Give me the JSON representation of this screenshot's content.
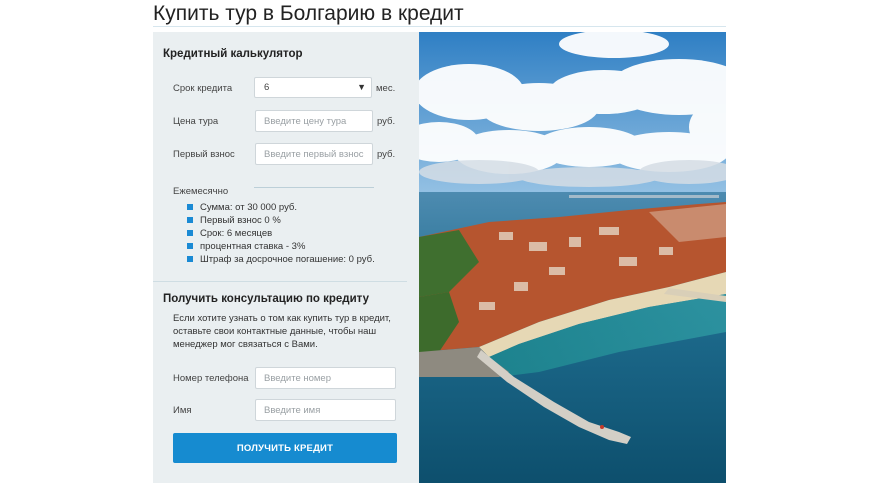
{
  "page": {
    "title": "Купить тур в Болгарию в кредит"
  },
  "calculator": {
    "heading": "Кредитный калькулятор",
    "term": {
      "label": "Срок кредита",
      "value": "6",
      "unit": "мес."
    },
    "price": {
      "label": "Цена тура",
      "placeholder": "Введите цену тура",
      "unit": "руб."
    },
    "down_payment": {
      "label": "Первый взнос",
      "placeholder": "Введите первый взнос",
      "unit": "руб."
    },
    "monthly_label": "Ежемесячно",
    "conditions": [
      "Сумма: от 30 000 руб.",
      "Первый взнос 0 %",
      "Срок: 6 месяцев",
      "процентная ставка - 3%",
      "Штраф за досрочное погашение: 0 руб."
    ]
  },
  "consultation": {
    "heading": "Получить консультацию по кредиту",
    "description": "Если хотите узнать о том как купить тур в кредит, оставьте свои контактные данные, чтобы наш менеджер мог связаться с Вами.",
    "phone": {
      "label": "Номер телефона",
      "placeholder": "Введите номер"
    },
    "name": {
      "label": "Имя",
      "placeholder": "Введите имя"
    },
    "submit_label": "Получить кредит"
  },
  "colors": {
    "accent": "#168bd0",
    "panel_bg": "#eaeff1",
    "bullet": "#1a8ad4"
  }
}
